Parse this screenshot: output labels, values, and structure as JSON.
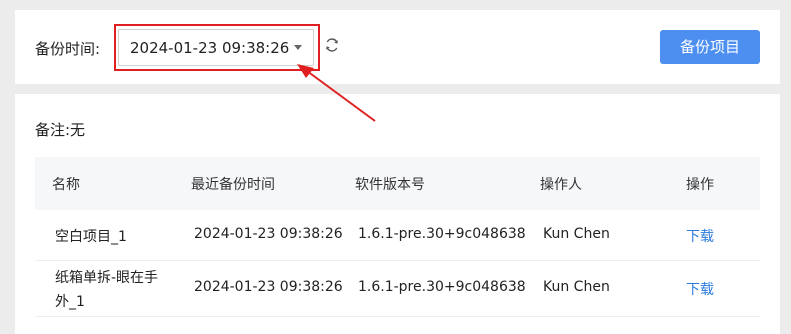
{
  "header": {
    "backup_time_label": "备份时间:",
    "selected_time": "2024-01-23 09:38:26",
    "backup_project_button": "备份项目"
  },
  "note": "备注:无",
  "table": {
    "columns": [
      "名称",
      "最近备份时间",
      "软件版本号",
      "操作人",
      "操作"
    ],
    "rows": [
      {
        "name": "空白项目_1",
        "name_line2": "",
        "time": "2024-01-23 09:38:26",
        "version": "1.6.1-pre.30+9c048638",
        "operator": "Kun Chen",
        "action": "下载"
      },
      {
        "name": "纸箱单拆-眼在手",
        "name_line2": "外_1",
        "time": "2024-01-23 09:38:26",
        "version": "1.6.1-pre.30+9c048638",
        "operator": "Kun Chen",
        "action": "下载"
      }
    ]
  },
  "colors": {
    "primary": "#4d8ff0",
    "highlight": "#e02020",
    "link": "#2d7be0"
  },
  "icons": {
    "caret": "caret-down-icon",
    "refresh": "refresh-icon"
  }
}
